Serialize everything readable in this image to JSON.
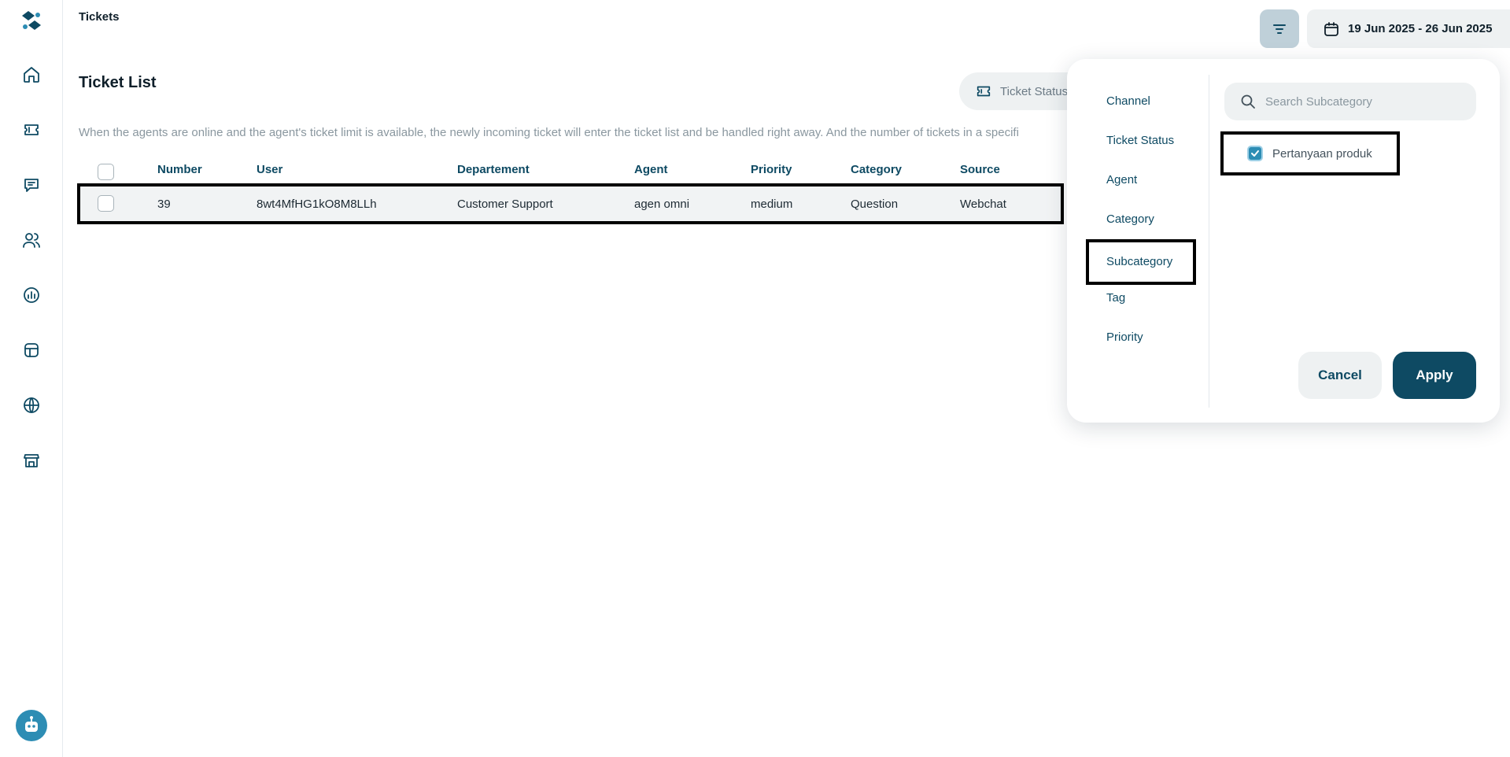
{
  "header": {
    "page_title": "Tickets",
    "date_range": "19 Jun 2025 - 26 Jun 2025",
    "filter_icon": "filter-icon",
    "calendar_icon": "calendar-icon"
  },
  "sidebar": {
    "items": [
      {
        "icon": "home-icon"
      },
      {
        "icon": "ticket-icon"
      },
      {
        "icon": "chat-icon"
      },
      {
        "icon": "users-icon"
      },
      {
        "icon": "report-icon"
      },
      {
        "icon": "layout-icon"
      },
      {
        "icon": "globe-icon"
      },
      {
        "icon": "store-icon"
      }
    ],
    "bot_icon": "bot-avatar-icon"
  },
  "main": {
    "list_title": "Ticket List",
    "status_button": "Ticket Status",
    "info_text": "When the agents are online and the agent's ticket limit is available, the newly incoming ticket will enter the ticket list and be handled right away. And the number of tickets in a specifi"
  },
  "table": {
    "columns": [
      "Number",
      "User",
      "Departement",
      "Agent",
      "Priority",
      "Category",
      "Source"
    ],
    "rows": [
      {
        "number": "39",
        "user": "8wt4MfHG1kO8M8LLh",
        "department": "Customer Support",
        "agent": "agen omni",
        "priority": "medium",
        "category": "Question",
        "source": "Webchat",
        "checked": false
      }
    ]
  },
  "filter_panel": {
    "categories": [
      "Channel",
      "Ticket Status",
      "Agent",
      "Category",
      "Subcategory",
      "Tag",
      "Priority"
    ],
    "selected_category": "Subcategory",
    "search_placeholder": "Search Subcategory",
    "options": [
      {
        "label": "Pertanyaan produk",
        "checked": true
      }
    ],
    "cancel_label": "Cancel",
    "apply_label": "Apply"
  },
  "colors": {
    "primary": "#0e4a63",
    "accent": "#2d8db4",
    "muted_text": "#8a979f",
    "panel_bg": "#eef1f2"
  }
}
